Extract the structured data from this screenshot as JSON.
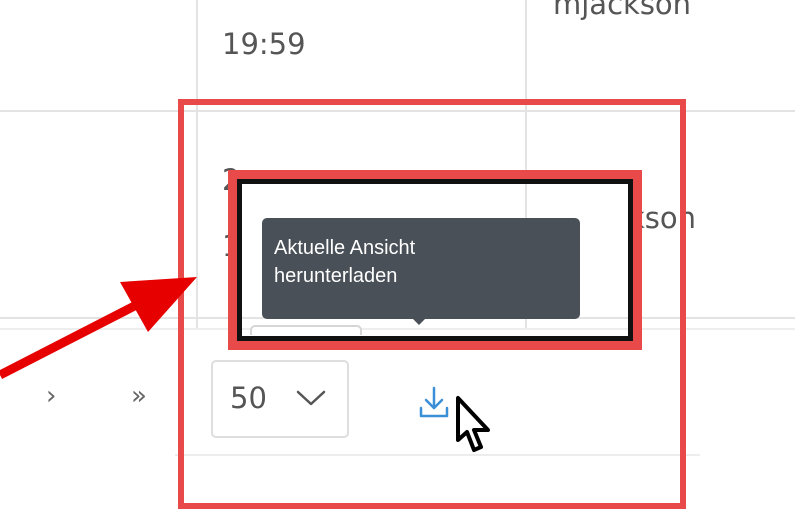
{
  "table": {
    "row1": {
      "time": "19:59",
      "user": "mjackson"
    },
    "row2": {
      "time_partial_top": "2",
      "time_partial_bottom": "1",
      "user": "kson"
    }
  },
  "pagination": {
    "next_label": "›",
    "last_label": "»",
    "page_size_value": "50"
  },
  "tooltip": {
    "line1": "Aktuelle Ansicht",
    "line2": "herunterladen"
  },
  "icons": {
    "download": "download-icon",
    "chevron": "chevron-down-icon",
    "cursor": "hand-pointer-cursor",
    "annotation_arrow": "red-arrow"
  },
  "colors": {
    "annotation_red": "#e84a4a",
    "annotation_black": "#111111",
    "tooltip_bg": "#495057",
    "download_blue": "#3b8fd6",
    "grid": "#e3e3e3",
    "text": "#555555"
  }
}
